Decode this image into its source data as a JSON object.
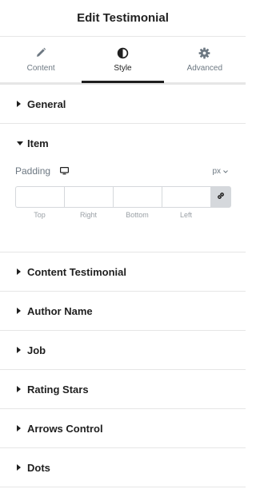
{
  "header": {
    "title": "Edit Testimonial"
  },
  "tabs": [
    {
      "label": "Content",
      "icon": "pencil-icon"
    },
    {
      "label": "Style",
      "icon": "contrast-icon",
      "active": true
    },
    {
      "label": "Advanced",
      "icon": "gear-icon"
    }
  ],
  "sections": {
    "general": "General",
    "item": "Item",
    "content_testimonial": "Content Testimonial",
    "author_name": "Author Name",
    "job": "Job",
    "rating_stars": "Rating Stars",
    "arrows_control": "Arrows Control",
    "dots": "Dots"
  },
  "padding": {
    "label": "Padding",
    "device_icon": "desktop-icon",
    "unit": "px",
    "fields": [
      {
        "label": "Top",
        "value": ""
      },
      {
        "label": "Right",
        "value": ""
      },
      {
        "label": "Bottom",
        "value": ""
      },
      {
        "label": "Left",
        "value": ""
      }
    ],
    "link_icon": "link-icon"
  },
  "colors": {
    "text": "#1f1f1f",
    "muted": "#6d7882",
    "border": "#e6e6e6",
    "link_bg": "#d5d8dc"
  }
}
